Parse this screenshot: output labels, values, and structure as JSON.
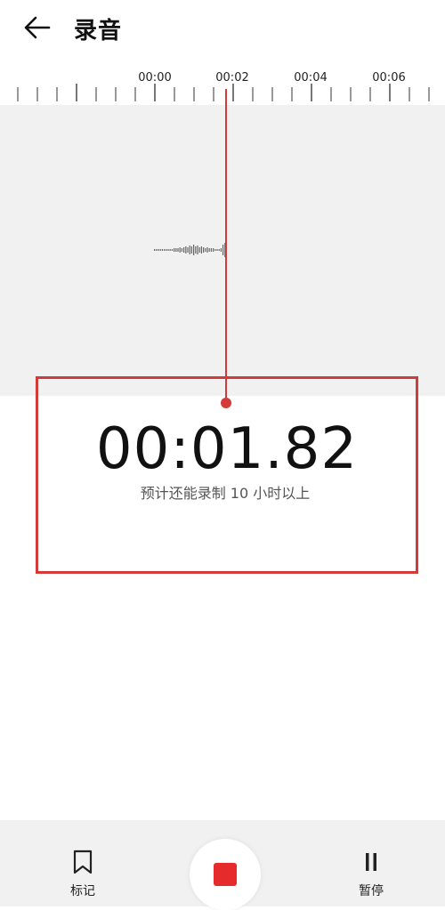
{
  "header": {
    "title": "录音",
    "back_icon": "arrow-left-icon"
  },
  "ruler": {
    "labels": [
      "00:00",
      "00:02",
      "00:04",
      "00:06"
    ]
  },
  "recording": {
    "elapsed": "00:01.82",
    "remaining_text": "预计还能录制 10 小时以上"
  },
  "colors": {
    "accent_red": "#e52b2b",
    "playhead": "#d33b3b",
    "wave_background": "#f1f1f1"
  },
  "controls": {
    "mark_label": "标记",
    "mark_icon": "bookmark-icon",
    "stop_icon": "stop-icon",
    "pause_label": "暂停",
    "pause_icon": "pause-icon"
  }
}
